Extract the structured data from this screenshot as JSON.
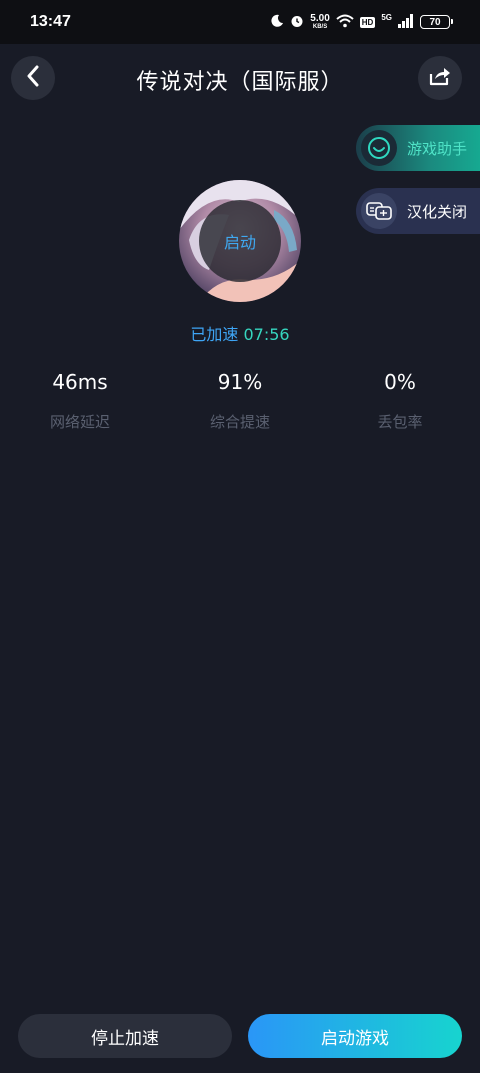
{
  "status_bar": {
    "time": "13:47",
    "speed_value": "5.00",
    "speed_unit": "KB/S",
    "hd_badge": "HD",
    "network": "5G",
    "battery": "70"
  },
  "header": {
    "title": "传说对决（国际服）"
  },
  "side_actions": {
    "helper_label": "游戏助手",
    "translate_label": "汉化关闭"
  },
  "avatar": {
    "overlay_label": "启动"
  },
  "acceleration": {
    "prefix": "已加速",
    "elapsed": "07:56"
  },
  "stats": [
    {
      "value": "46ms",
      "label": "网络延迟"
    },
    {
      "value": "91%",
      "label": "综合提速"
    },
    {
      "value": "0%",
      "label": "丢包率"
    }
  ],
  "buttons": {
    "stop_label": "停止加速",
    "start_label": "启动游戏"
  },
  "colors": {
    "background": "#181b26",
    "accent_blue": "#3ea5f5",
    "accent_teal": "#36d6c0",
    "button_dark": "#2b2f3b"
  },
  "icons": {
    "back": "chevron-left-icon",
    "share": "share-icon",
    "helper": "assistant-icon",
    "translate": "translate-icon"
  }
}
